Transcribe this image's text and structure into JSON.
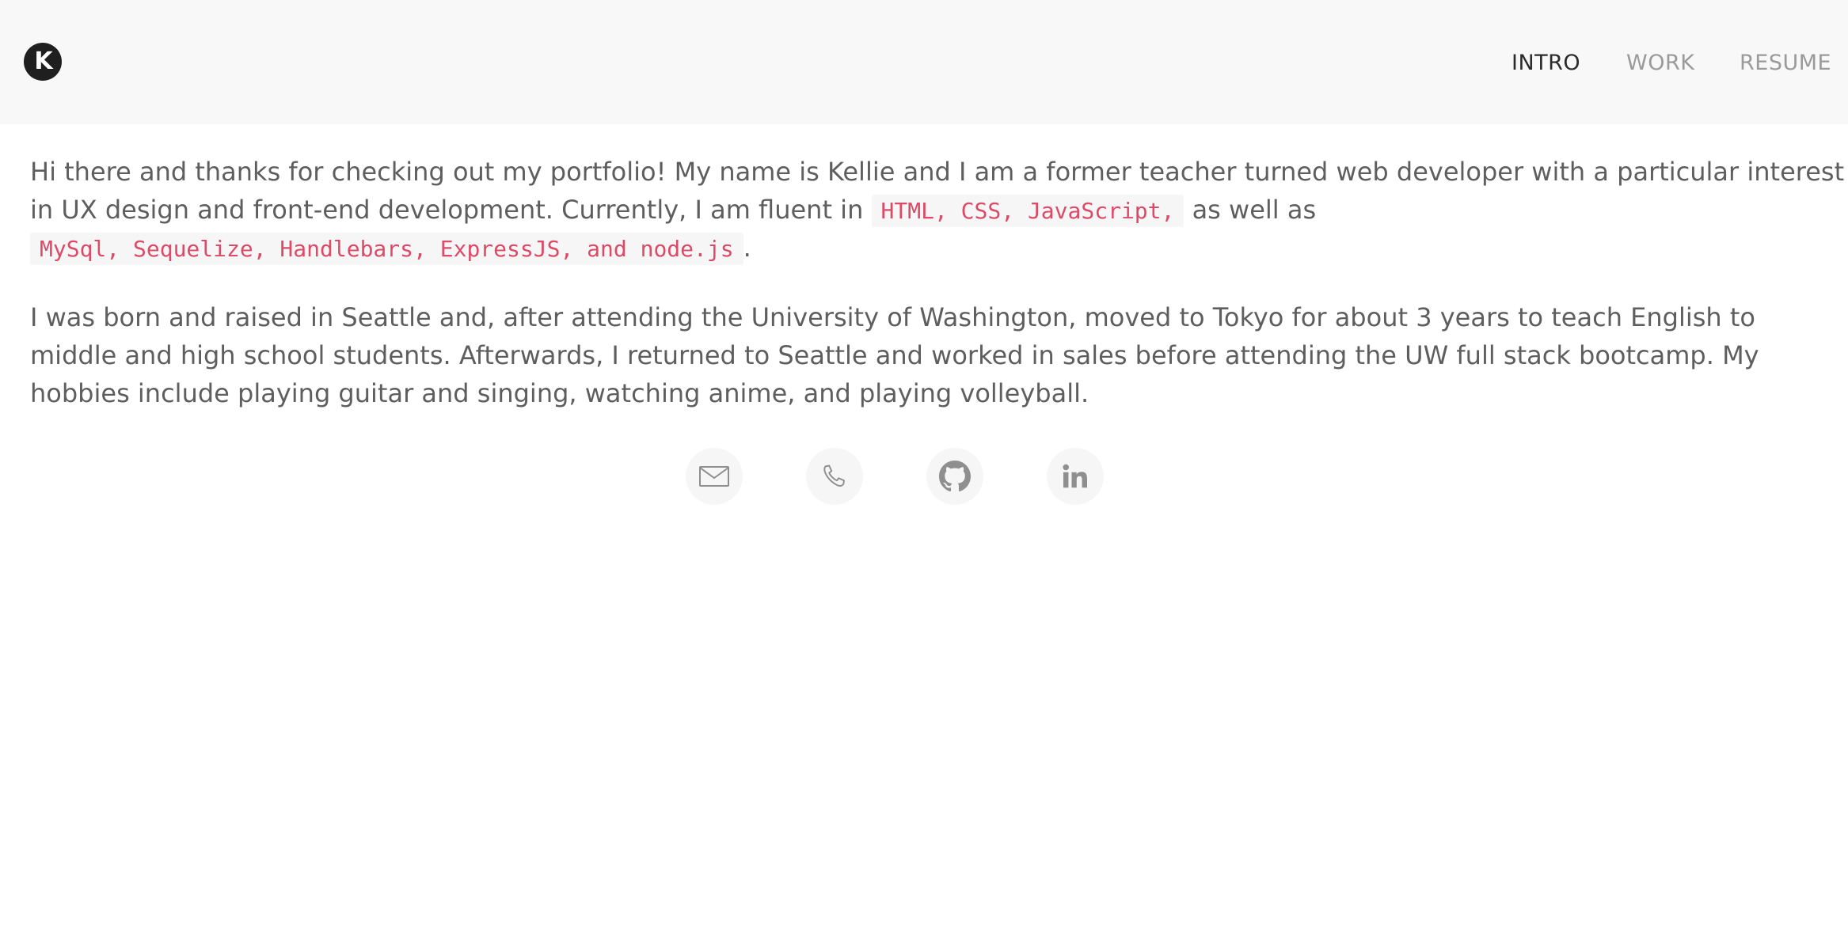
{
  "header": {
    "logo_text": "K",
    "nav": [
      {
        "label": "INTRO",
        "active": true
      },
      {
        "label": "WORK",
        "active": false
      },
      {
        "label": "RESUME",
        "active": false
      }
    ]
  },
  "intro": {
    "p1_line1": "Hi there and thanks for checking out my portfolio! My name is Kellie and I am a former teacher turned web developer with a particular interest",
    "p1_line2_prefix": "in UX design and front-end development. Currently, I am fluent in",
    "p1_code1": "HTML, CSS, JavaScript,",
    "p1_line2_suffix": "as well as",
    "p1_code2": "MySql, Sequelize, Handlebars, ExpressJS, and node.js",
    "p1_end": ".",
    "p2_line1": "I was born and raised in Seattle and, after attending the University of Washington, moved to Tokyo for about 3 years to teach English to",
    "p2_line2": "middle and high school students. Afterwards, I returned to Seattle and worked in sales before attending the UW full stack bootcamp. My",
    "p2_line3": "hobbies include playing guitar and singing, watching anime, and playing volleyball."
  },
  "social_links": [
    {
      "icon": "email-icon"
    },
    {
      "icon": "phone-icon"
    },
    {
      "icon": "github-icon"
    },
    {
      "icon": "linkedin-icon"
    }
  ],
  "colors": {
    "header_bg": "#f8f8f8",
    "code_text": "#dd4a68",
    "code_bg": "#f6f6f6",
    "body_text": "#5e5e5e",
    "nav_active": "#2b2b2b",
    "nav_inactive": "#9a9a9a"
  }
}
